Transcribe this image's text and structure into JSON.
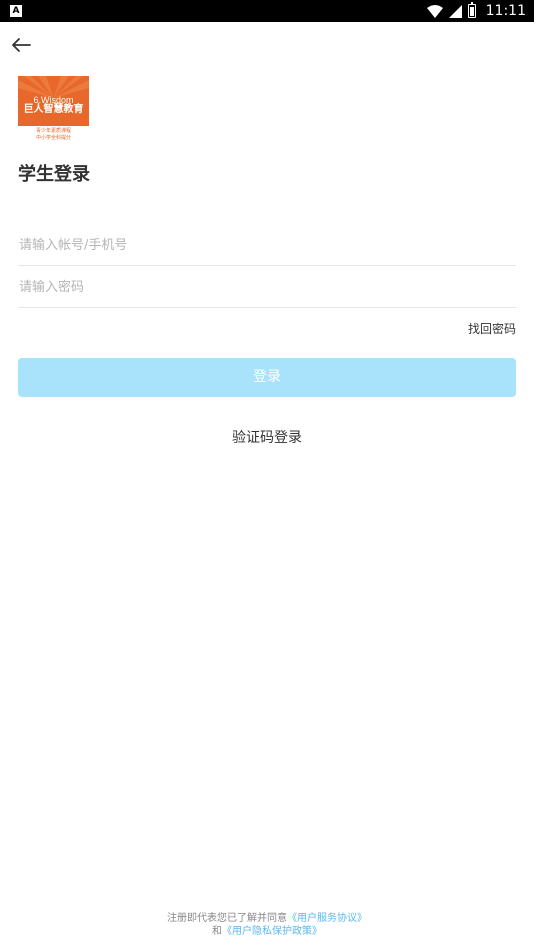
{
  "status_bar": {
    "left_icon": "A",
    "time": "11:11",
    "icons": [
      "wifi-icon",
      "signal-icon",
      "battery-icon"
    ]
  },
  "header": {
    "back_icon": "back-arrow-icon"
  },
  "logo": {
    "english": "6.Wisdom",
    "chinese": "巨人智慧教育",
    "tagline_1": "青少年素质课程",
    "tagline_2": "中小学全科提分",
    "brand_color": "#e8672a"
  },
  "title": "学生登录",
  "form": {
    "account_placeholder": "请输入帐号/手机号",
    "account_value": "",
    "password_placeholder": "请输入密码",
    "password_value": "",
    "forgot_label": "找回密码",
    "login_label": "登录",
    "login_color": "#a8e2fb",
    "code_login_label": "验证码登录"
  },
  "agreement": {
    "prefix": "注册即代表您已了解并同意",
    "terms_link": "《用户服务协议》",
    "conjunction": "和",
    "privacy_link": "《用户隐私保护政策》",
    "link_color": "#5bb8ee"
  }
}
